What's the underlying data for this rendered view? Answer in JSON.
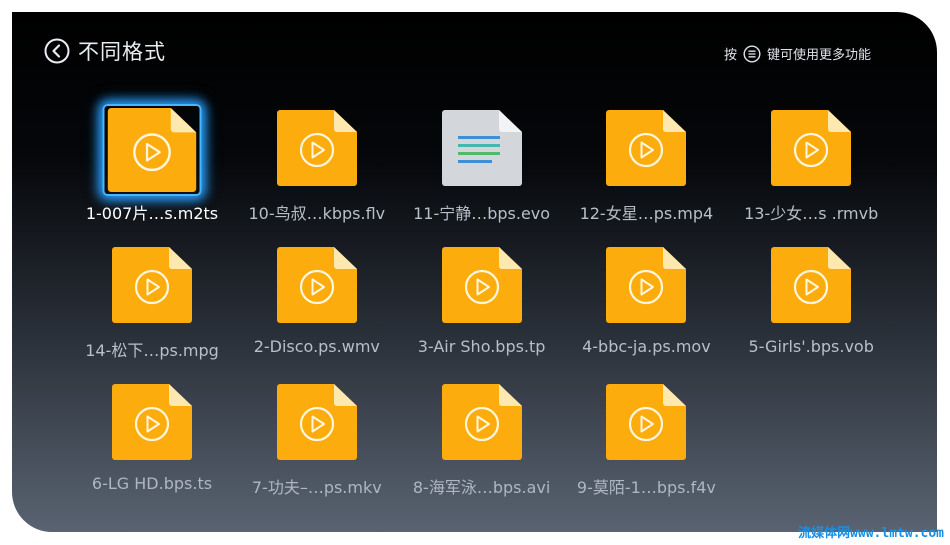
{
  "header": {
    "title": "不同格式",
    "hint_prefix": "按",
    "hint_suffix": "键可使用更多功能"
  },
  "colors": {
    "video_folder": "#fcac0c",
    "video_fold": "#fde9b0",
    "doc_file": "#d3d6db",
    "focus": "#3aa8ff"
  },
  "files": [
    {
      "name": "1-007片…s.m2ts",
      "type": "video",
      "focused": true
    },
    {
      "name": "10-鸟叔…kbps.flv",
      "type": "video",
      "focused": false
    },
    {
      "name": "11-宁静…bps.evo",
      "type": "document",
      "focused": false
    },
    {
      "name": "12-女星…ps.mp4",
      "type": "video",
      "focused": false
    },
    {
      "name": "13-少女…s .rmvb",
      "type": "video",
      "focused": false
    },
    {
      "name": "14-松下…ps.mpg",
      "type": "video",
      "focused": false
    },
    {
      "name": "2-Disco.ps.wmv",
      "type": "video",
      "focused": false
    },
    {
      "name": "3-Air Sho.bps.tp",
      "type": "video",
      "focused": false
    },
    {
      "name": "4-bbc-ja.ps.mov",
      "type": "video",
      "focused": false
    },
    {
      "name": "5-Girls'.bps.vob",
      "type": "video",
      "focused": false
    },
    {
      "name": "6-LG HD.bps.ts",
      "type": "video",
      "focused": false
    },
    {
      "name": "7-功夫–…ps.mkv",
      "type": "video",
      "focused": false
    },
    {
      "name": "8-海军泳…bps.avi",
      "type": "video",
      "focused": false
    },
    {
      "name": "9-莫陌-1…bps.f4v",
      "type": "video",
      "focused": false
    }
  ],
  "watermark": "流媒体网www.lmtw.com"
}
